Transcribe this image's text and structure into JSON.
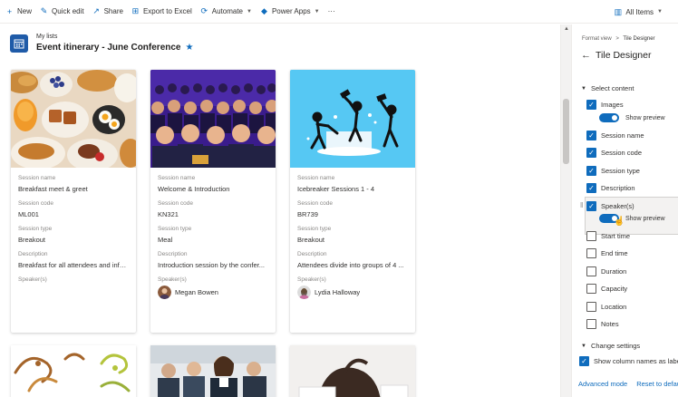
{
  "toolbar": {
    "new": "New",
    "quick_edit": "Quick edit",
    "share": "Share",
    "export": "Export to Excel",
    "automate": "Automate",
    "power_apps": "Power Apps",
    "more": "···",
    "view": "All Items"
  },
  "header": {
    "breadcrumb": "My lists",
    "title": "Event itinerary - June Conference"
  },
  "cards": [
    {
      "session_name_label": "Session name",
      "session_name": "Breakfast meet & greet",
      "session_code_label": "Session code",
      "session_code": "ML001",
      "session_type_label": "Session type",
      "session_type": "Breakout",
      "description_label": "Description",
      "description": "Breakfast for all attendees and info...",
      "speakers_label": "Speaker(s)",
      "speaker": ""
    },
    {
      "session_name_label": "Session name",
      "session_name": "Welcome & Introduction",
      "session_code_label": "Session code",
      "session_code": "KN321",
      "session_type_label": "Session type",
      "session_type": "Meal",
      "description_label": "Description",
      "description": "Introduction session by the confer...",
      "speakers_label": "Speaker(s)",
      "speaker": "Megan Bowen"
    },
    {
      "session_name_label": "Session name",
      "session_name": "Icebreaker Sessions 1 - 4",
      "session_code_label": "Session code",
      "session_code": "BR739",
      "session_type_label": "Session type",
      "session_type": "Breakout",
      "description_label": "Description",
      "description": "Attendees divide into groups of 4 ...",
      "speakers_label": "Speaker(s)",
      "speaker": "Lydia Halloway"
    }
  ],
  "panel": {
    "breadcrumb_parent": "Format view",
    "breadcrumb_sep": ">",
    "breadcrumb_current": "Tile Designer",
    "title": "Tile Designer",
    "select_content": "Select content",
    "options": [
      {
        "label": "Images",
        "checked": true
      },
      {
        "label": "Session name",
        "checked": true
      },
      {
        "label": "Session code",
        "checked": true
      },
      {
        "label": "Session type",
        "checked": true
      },
      {
        "label": "Description",
        "checked": true
      },
      {
        "label": "Speaker(s)",
        "checked": true
      },
      {
        "label": "Start time",
        "checked": false
      },
      {
        "label": "End time",
        "checked": false
      },
      {
        "label": "Duration",
        "checked": false
      },
      {
        "label": "Capacity",
        "checked": false
      },
      {
        "label": "Location",
        "checked": false
      },
      {
        "label": "Notes",
        "checked": false
      }
    ],
    "show_preview": "Show preview",
    "change_settings": "Change settings",
    "show_column_names": "Show column names as labe",
    "advanced_mode": "Advanced mode",
    "reset": "Reset to defau"
  },
  "colors": {
    "accent": "#0f6cbd",
    "list_icon": "#1f5ba8",
    "card_sky": "#56c8f3"
  }
}
